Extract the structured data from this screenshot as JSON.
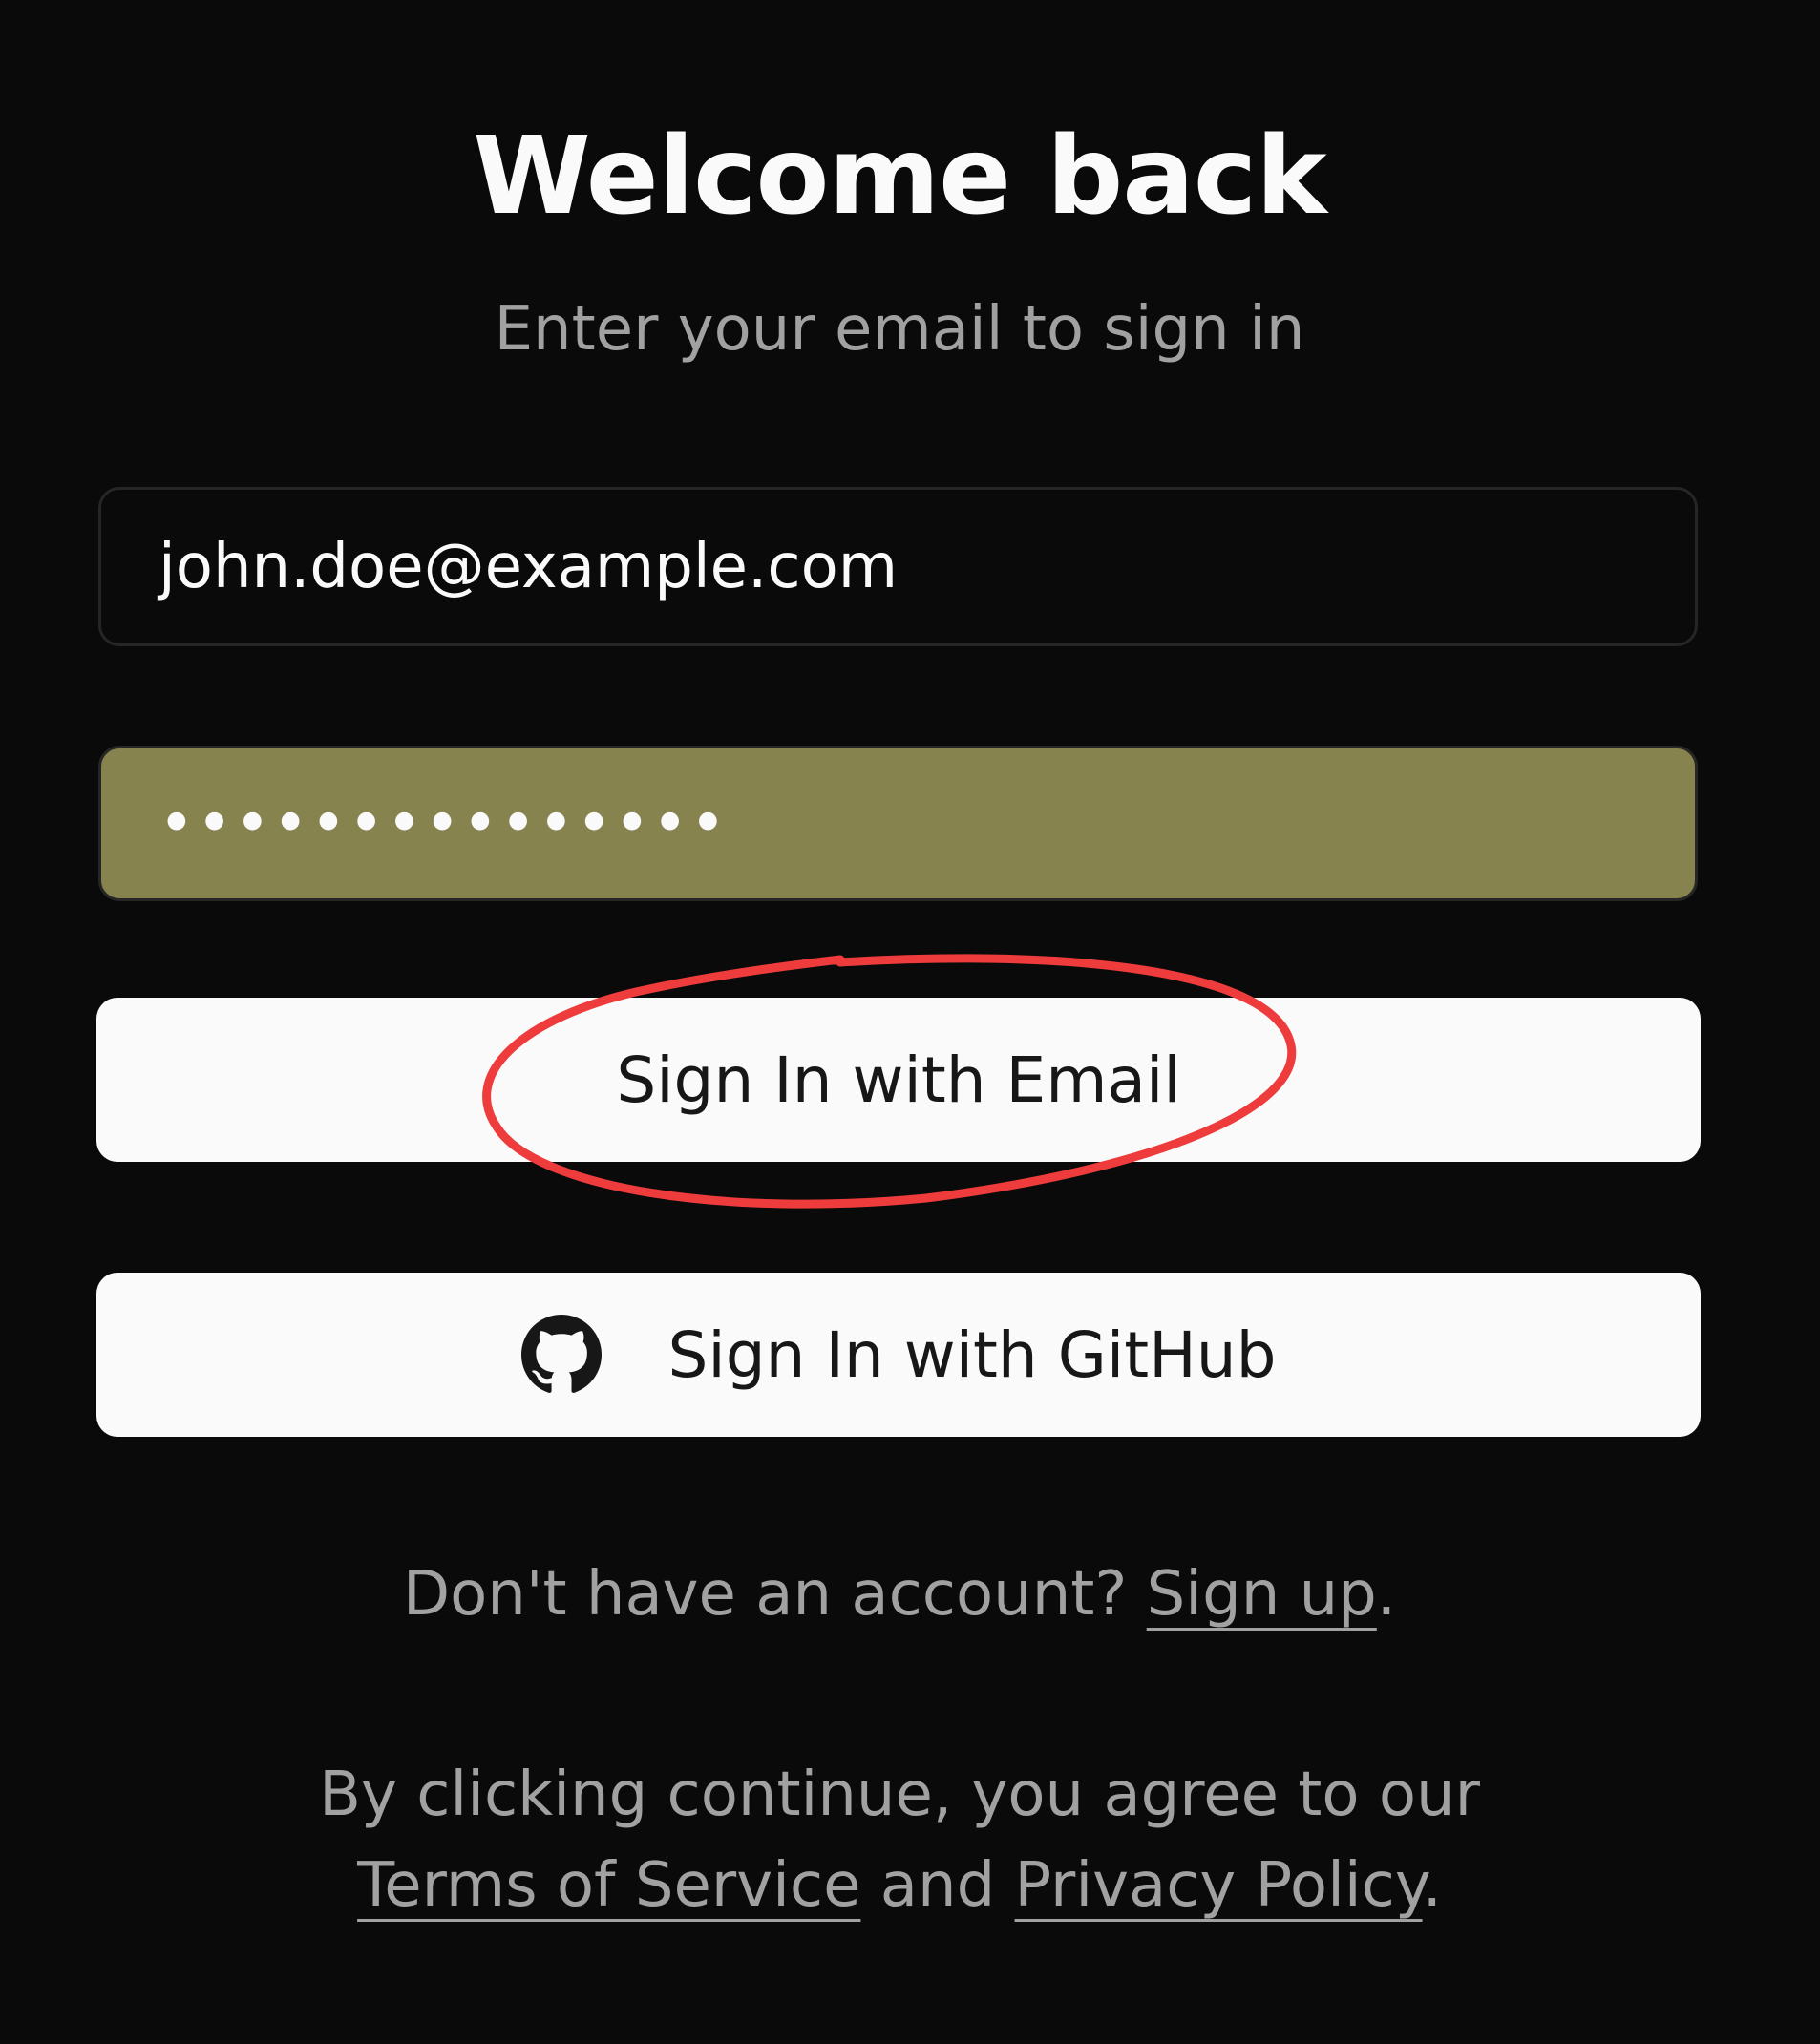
{
  "header": {
    "title": "Welcome back",
    "subtitle": "Enter your email to sign in"
  },
  "form": {
    "email_value": "john.doe@example.com",
    "password_value": "•••••••••••••••",
    "email_button_label": "Sign In with Email",
    "github_button_label": "Sign In with GitHub"
  },
  "footer": {
    "signup_prompt": "Don't have an account? ",
    "signup_link": "Sign up",
    "signup_suffix": ".",
    "terms_prefix": "By clicking continue, you agree to our",
    "terms_link": "Terms of Service",
    "terms_and": " and ",
    "privacy_link": "Privacy Policy",
    "terms_suffix": "."
  },
  "icons": {
    "github": "github-icon"
  },
  "colors": {
    "background": "#0a0a0a",
    "password_autofill": "#86834f",
    "button_background": "#fafafa",
    "annotation": "#ee3b3b"
  }
}
